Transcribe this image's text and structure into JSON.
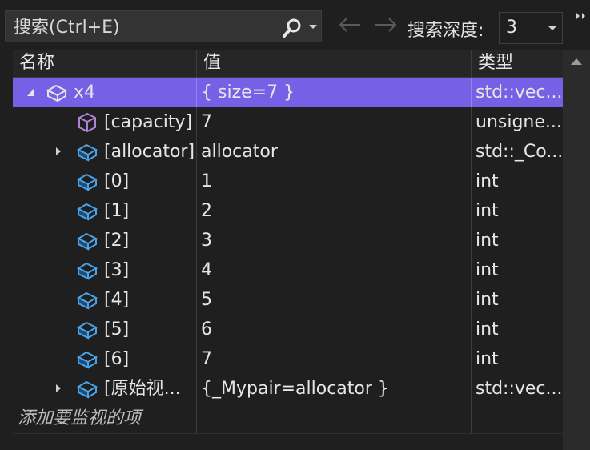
{
  "toolbar": {
    "search_placeholder": "搜索(Ctrl+E)",
    "depth_label": "搜索深度:",
    "depth_value": "3"
  },
  "columns": {
    "name": "名称",
    "value": "值",
    "type": "类型"
  },
  "rows": [
    {
      "name": "x4",
      "value": "{ size=7 }",
      "type": "std::vec...",
      "selected": true
    },
    {
      "name": "[capacity]",
      "value": "7",
      "type": "unsigne..."
    },
    {
      "name": "[allocator]",
      "value": "allocator",
      "type": "std::_Co..."
    },
    {
      "name": "[0]",
      "value": "1",
      "type": "int"
    },
    {
      "name": "[1]",
      "value": "2",
      "type": "int"
    },
    {
      "name": "[2]",
      "value": "3",
      "type": "int"
    },
    {
      "name": "[3]",
      "value": "4",
      "type": "int"
    },
    {
      "name": "[4]",
      "value": "5",
      "type": "int"
    },
    {
      "name": "[5]",
      "value": "6",
      "type": "int"
    },
    {
      "name": "[6]",
      "value": "7",
      "type": "int"
    },
    {
      "name": "[原始视...",
      "value": "{_Mypair=allocator }",
      "type": "std::vec..."
    }
  ],
  "add_watch_placeholder": "添加要监视的项",
  "colors": {
    "selected_row": "#7560e6",
    "icon_blue": "#4aa3e8",
    "icon_purple": "#b180d7"
  }
}
